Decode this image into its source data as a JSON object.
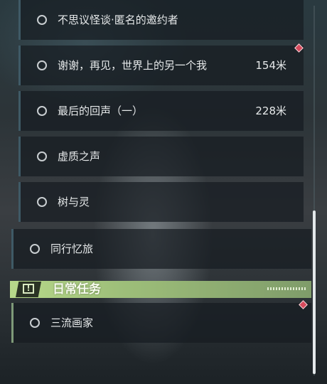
{
  "quests": {
    "items": [
      {
        "title": "不思议怪谈·匿名的邀约者",
        "distance": ""
      },
      {
        "title": "谢谢，再见，世界上的另一个我",
        "distance": "154米"
      },
      {
        "title": "最后的回声（一）",
        "distance": "228米"
      },
      {
        "title": "虚质之声",
        "distance": ""
      },
      {
        "title": "树与灵",
        "distance": ""
      }
    ],
    "parent": {
      "title": "同行忆旅"
    }
  },
  "daily": {
    "section_title": "日常任务",
    "items": [
      {
        "title": "三流画家"
      }
    ]
  },
  "colors": {
    "accent_green": "#b7d98a",
    "marker_red": "#d64a5c"
  },
  "icons": {
    "section": "alert-box-icon",
    "marker": "red-diamond-marker-icon",
    "status": "empty-circle-icon"
  }
}
